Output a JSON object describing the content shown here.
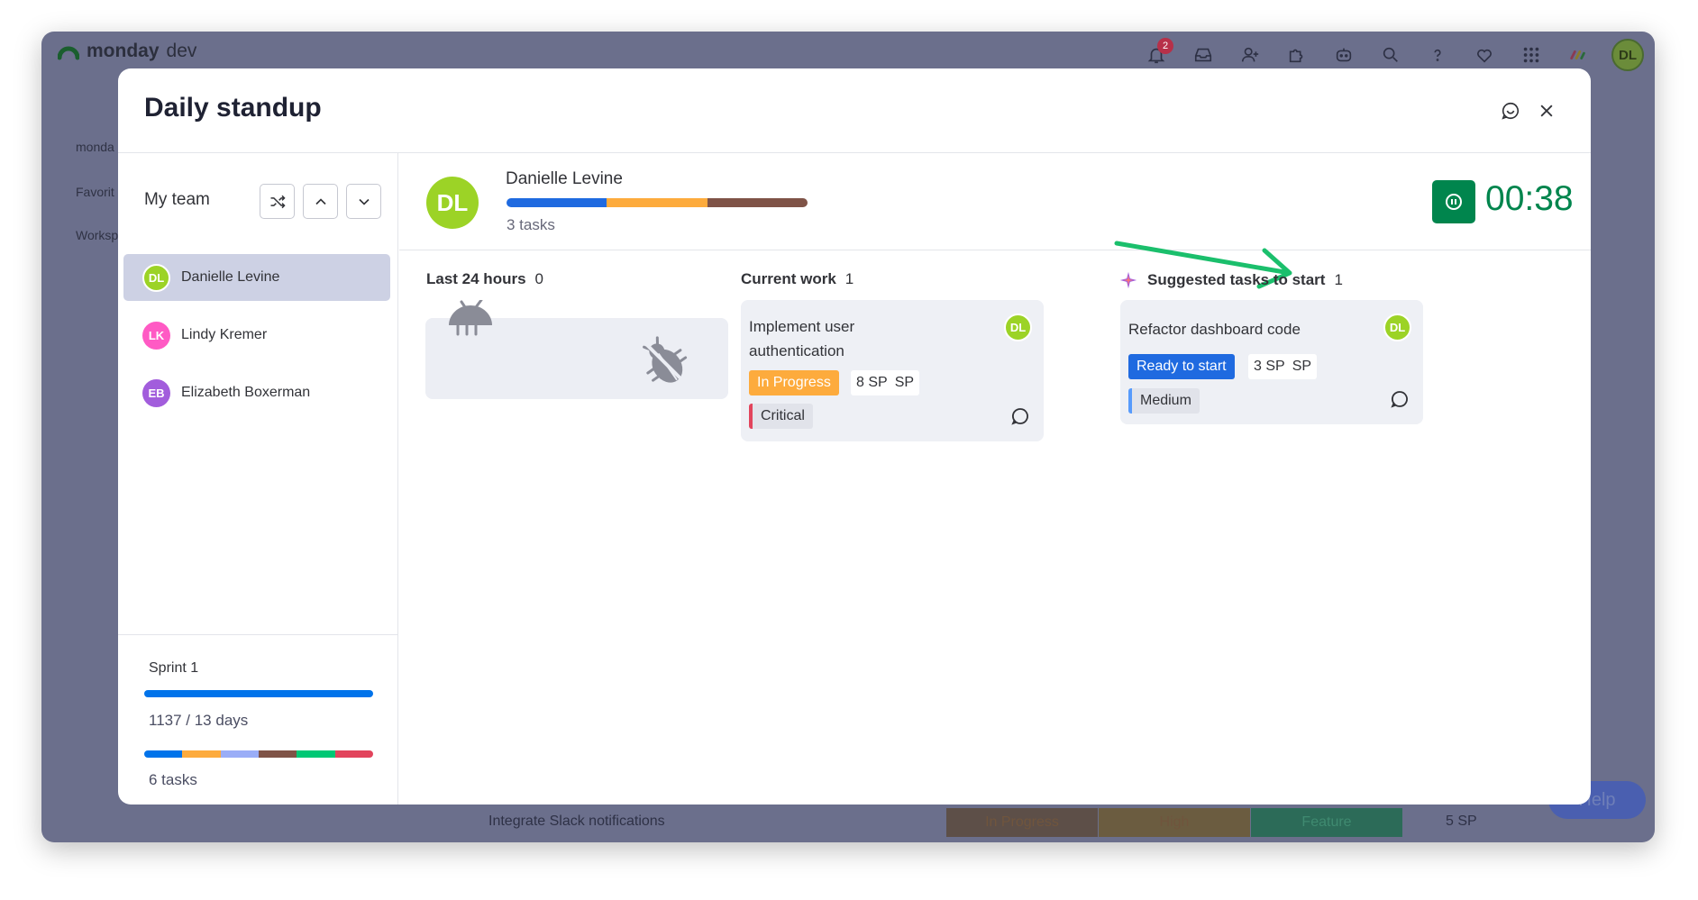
{
  "app": {
    "brand_bold": "monday",
    "brand_light": "dev",
    "notification_count": "2",
    "user_initials": "DL"
  },
  "background": {
    "row_task": "Integrate Slack notifications",
    "row_status": "In Progress",
    "row_priority": "High",
    "row_type": "Feature",
    "row_sp": "5 SP",
    "help_label": "Help"
  },
  "modal": {
    "title": "Daily standup"
  },
  "team": {
    "header": "My team",
    "members": [
      {
        "initials": "DL",
        "name": "Danielle Levine",
        "color": "#9cd326"
      },
      {
        "initials": "LK",
        "name": "Lindy Kremer",
        "color": "#ff5ac4"
      },
      {
        "initials": "EB",
        "name": "Elizabeth Boxerman",
        "color": "#a25ddc"
      }
    ]
  },
  "sprint": {
    "name": "Sprint 1",
    "days": "1137 / 13 days",
    "tasks": "6 tasks",
    "bar_colors": [
      "#0073ea",
      "#fdab3d",
      "#9aadf7",
      "#7f5347",
      "#00c875",
      "#e2445c"
    ]
  },
  "person": {
    "initials": "DL",
    "name": "Danielle Levine",
    "tasks": "3 tasks",
    "bar_colors": [
      "#1f6ae0",
      "#fdab3d",
      "#7f5347"
    ],
    "timer": "00:38"
  },
  "columns": {
    "last24": {
      "title": "Last 24 hours",
      "count": "0"
    },
    "current": {
      "title": "Current work",
      "count": "1"
    },
    "suggested": {
      "title": "Suggested tasks to start",
      "count": "1"
    }
  },
  "cards": {
    "current": {
      "title_line1": "Implement user",
      "title_line2": "authentication",
      "assignee": "DL",
      "status": "In Progress",
      "status_color": "#fdab3d",
      "sp_value": "8 SP",
      "sp_unit": "SP",
      "priority": "Critical",
      "priority_color": "#e2445c"
    },
    "suggested": {
      "title": "Refactor dashboard code",
      "assignee": "DL",
      "status": "Ready to start",
      "status_color": "#1f6ae0",
      "sp_value": "3 SP",
      "sp_unit": "SP",
      "priority": "Medium",
      "priority_color": "#579bfc"
    }
  },
  "colors": {
    "accent_green": "#00854d",
    "arrow_green": "#1bbf6c"
  }
}
